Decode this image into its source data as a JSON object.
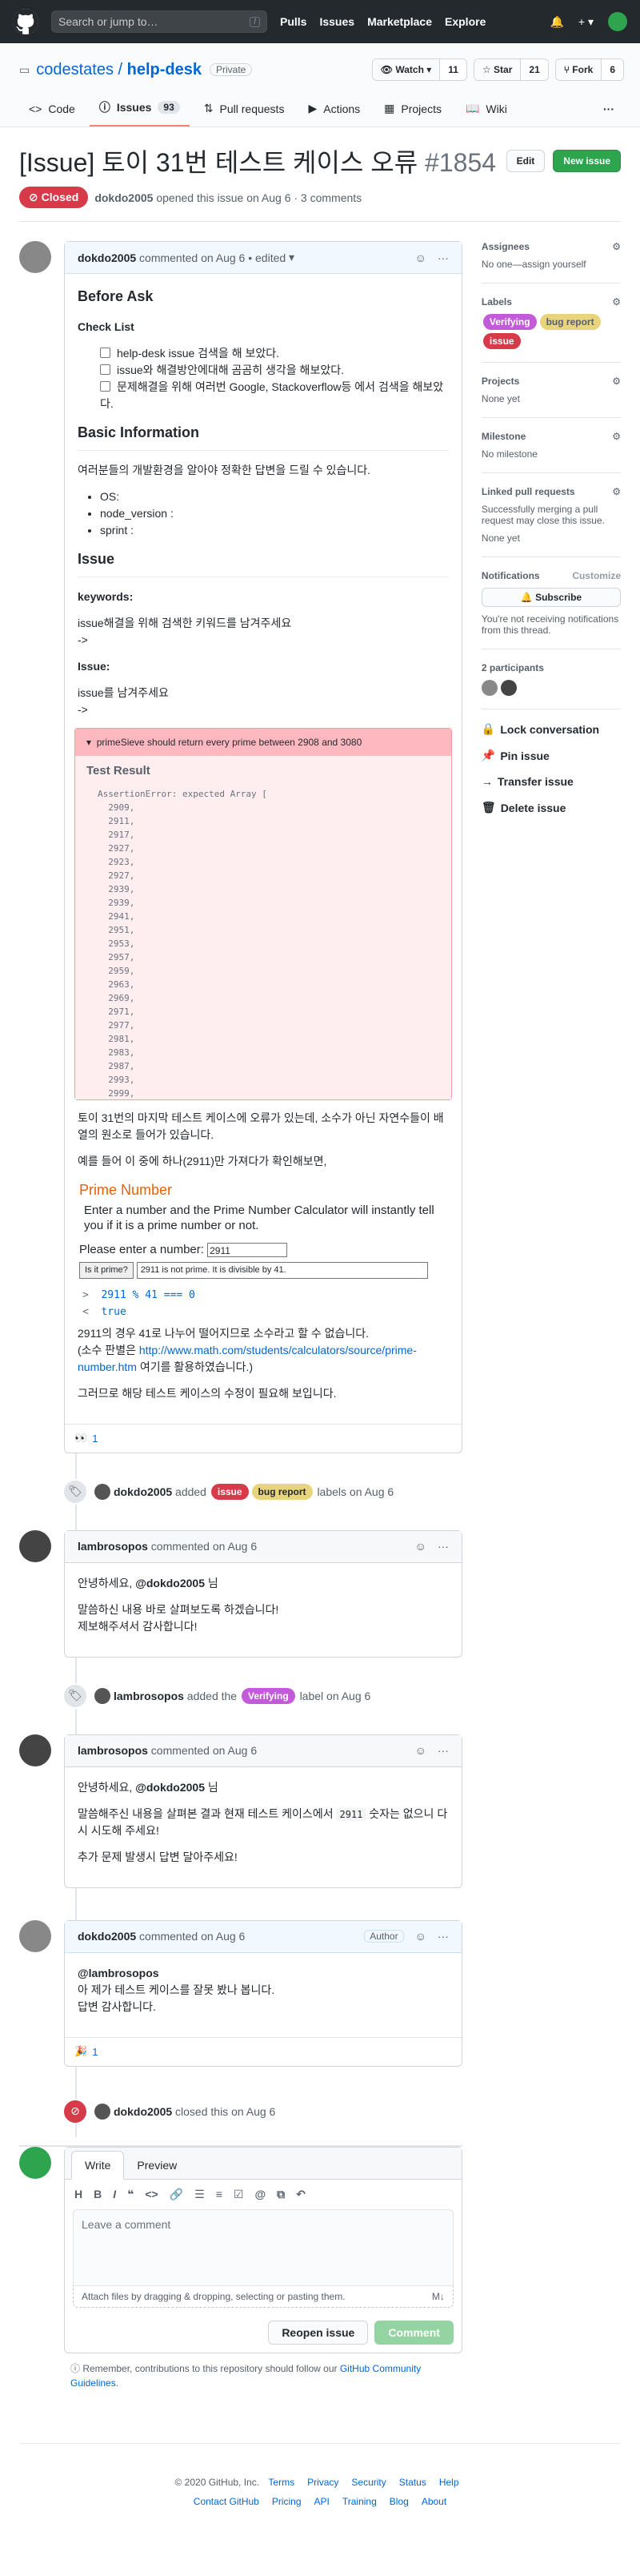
{
  "header": {
    "search_placeholder": "Search or jump to…",
    "search_key": "/",
    "nav": [
      "Pulls",
      "Issues",
      "Marketplace",
      "Explore"
    ]
  },
  "repo": {
    "owner": "codestates",
    "name": "help-desk",
    "visibility": "Private",
    "watch_label": "Watch",
    "watch_count": "11",
    "star_label": "Star",
    "star_count": "21",
    "fork_label": "Fork",
    "fork_count": "6"
  },
  "tabs": [
    {
      "label": "Code"
    },
    {
      "label": "Issues",
      "count": "93"
    },
    {
      "label": "Pull requests"
    },
    {
      "label": "Actions"
    },
    {
      "label": "Projects"
    },
    {
      "label": "Wiki"
    }
  ],
  "issue": {
    "title": "[Issue] 토이 31번 테스트 케이스 오류",
    "number": "#1854",
    "edit": "Edit",
    "new_issue": "New issue",
    "state": "Closed",
    "author": "dokdo2005",
    "meta": "opened this issue on Aug 6 · 3 comments"
  },
  "c1": {
    "author": "dokdo2005",
    "meta": "commented on Aug 6",
    "edited": "• edited",
    "h_before": "Before Ask",
    "h_check": "Check List",
    "checks": [
      "help-desk issue 검색을 해 보았다.",
      "issue와 해결방안에대해 곰곰히 생각을 해보았다.",
      "문제해결을 위해 여러번 Google, Stackoverflow등 에서 검색을 해보았다."
    ],
    "h_basic": "Basic Information",
    "basic_p": "여러분들의 개발환경을 알아야 정확한 답변을 드릴 수 있습니다.",
    "bullets": [
      "OS:",
      "node_version :",
      "sprint :"
    ],
    "h_issue": "Issue",
    "kw": "keywords:",
    "kw_p": "issue해결을 위해 검색한 키워드를 남겨주세요",
    "arrow": "->",
    "iss": "Issue:",
    "iss_p": "issue를 남겨주세요",
    "err_summary": "primeSieve should return every prime between 2908 and 3080",
    "err_title": "Test Result",
    "err_pre": "AssertionError: expected Array [\n  2909,\n  2911,\n  2917,\n  2927,\n  2923,\n  2927,\n  2939,\n  2939,\n  2941,\n  2951,\n  2953,\n  2957,\n  2959,\n  2963,\n  2969,\n  2971,\n  2977,\n  2981,\n  2983,\n  2987,\n  2993,\n  2999,",
    "p1": "토이 31번의 마지막 테스트 케이스에 오류가 있는데, 소수가 아닌 자연수들이 배열의 원소로 들어가 있습니다.",
    "p2": "예를 들어 이 중에 하나(2911)만 가져다가 확인해보면,",
    "calc_title": "Prime Number",
    "calc_desc": "Enter a number and the Prime Number Calculator will instantly tell you if it is a prime number or not.",
    "calc_label": "Please enter a number:",
    "calc_value": "2911",
    "calc_btn": "Is it prime?",
    "calc_res": "2911 is not prime.  It is divisible by 41.",
    "cons_in": "2911 % 41 === 0",
    "cons_out": "true",
    "p3": "2911의 경우 41로 나누어 떨어지므로 소수라고 할 수 없습니다.",
    "p4a": "(소수 판별은 ",
    "p4link": "http://www.math.com/students/calculators/source/prime-number.htm",
    "p4b": " 여기를 활용하였습니다.)",
    "p5": "그러므로 해당 테스트 케이스의 수정이 필요해 보입니다.",
    "react_count": "1"
  },
  "ev1": {
    "user": "dokdo2005",
    "pre": "added",
    "labels": [
      "issue",
      "bug report"
    ],
    "post": "labels on Aug 6"
  },
  "c2": {
    "author": "lambrosopos",
    "meta": "commented on Aug 6",
    "l1a": "안녕하세요, ",
    "l1b": "@dokdo2005",
    "l1c": " 님",
    "l2": "말씀하신 내용 바로 살펴보도록 하겠습니다!",
    "l3": "제보해주셔서 감사합니다!"
  },
  "ev2": {
    "user": "lambrosopos",
    "pre": "added the",
    "label": "Verifying",
    "post": "label on Aug 6"
  },
  "c3": {
    "author": "lambrosopos",
    "meta": "commented on Aug 6",
    "l1a": "안녕하세요, ",
    "l1b": "@dokdo2005",
    "l1c": " 님",
    "l2a": "말씀해주신 내용을 살펴본 결과 현재 테스트 케이스에서 ",
    "l2code": "2911",
    "l2b": " 숫자는 없으니 다시 시도해 주세요!",
    "l3": "추가 문제 발생시 답변 달아주세요!"
  },
  "c4": {
    "author": "dokdo2005",
    "meta": "commented on Aug 6",
    "badge": "Author",
    "l1": "@lambrosopos",
    "l2": "아 제가 테스트 케이스를 잘못 봤나 봅니다.",
    "l3": "답변 감사합니다.",
    "react_count": "1"
  },
  "ev3": {
    "user": "dokdo2005",
    "text": "closed this on Aug 6"
  },
  "writer": {
    "tab_write": "Write",
    "tab_preview": "Preview",
    "placeholder": "Leave a comment",
    "attach": "Attach files by dragging & dropping, selecting or pasting them.",
    "reopen": "Reopen issue",
    "comment": "Comment",
    "tip_a": "Remember, contributions to this repository should follow our ",
    "tip_link": "GitHub Community Guidelines",
    "tip_b": "."
  },
  "sidebar": {
    "assignees": "Assignees",
    "assignees_v": "No one—assign yourself",
    "labels": "Labels",
    "label_list": [
      "Verifying",
      "bug report",
      "issue"
    ],
    "projects": "Projects",
    "projects_v": "None yet",
    "milestone": "Milestone",
    "milestone_v": "No milestone",
    "linked": "Linked pull requests",
    "linked_d": "Successfully merging a pull request may close this issue.",
    "linked_v": "None yet",
    "notif": "Notifications",
    "customize": "Customize",
    "subscribe": "Subscribe",
    "notif_d": "You're not receiving notifications from this thread.",
    "participants": "2 participants",
    "lock": "Lock conversation",
    "pin": "Pin issue",
    "transfer": "Transfer issue",
    "delete": "Delete issue"
  },
  "footer": {
    "copy": "© 2020 GitHub, Inc.",
    "row1": [
      "Terms",
      "Privacy",
      "Security",
      "Status",
      "Help"
    ],
    "row2": [
      "Contact GitHub",
      "Pricing",
      "API",
      "Training",
      "Blog",
      "About"
    ]
  },
  "colors": {
    "closed": "#d73a49",
    "verifying": "#e99695",
    "bug_report": "#e8d47c",
    "issue": "#d73a49",
    "primary": "#2ea44f"
  }
}
